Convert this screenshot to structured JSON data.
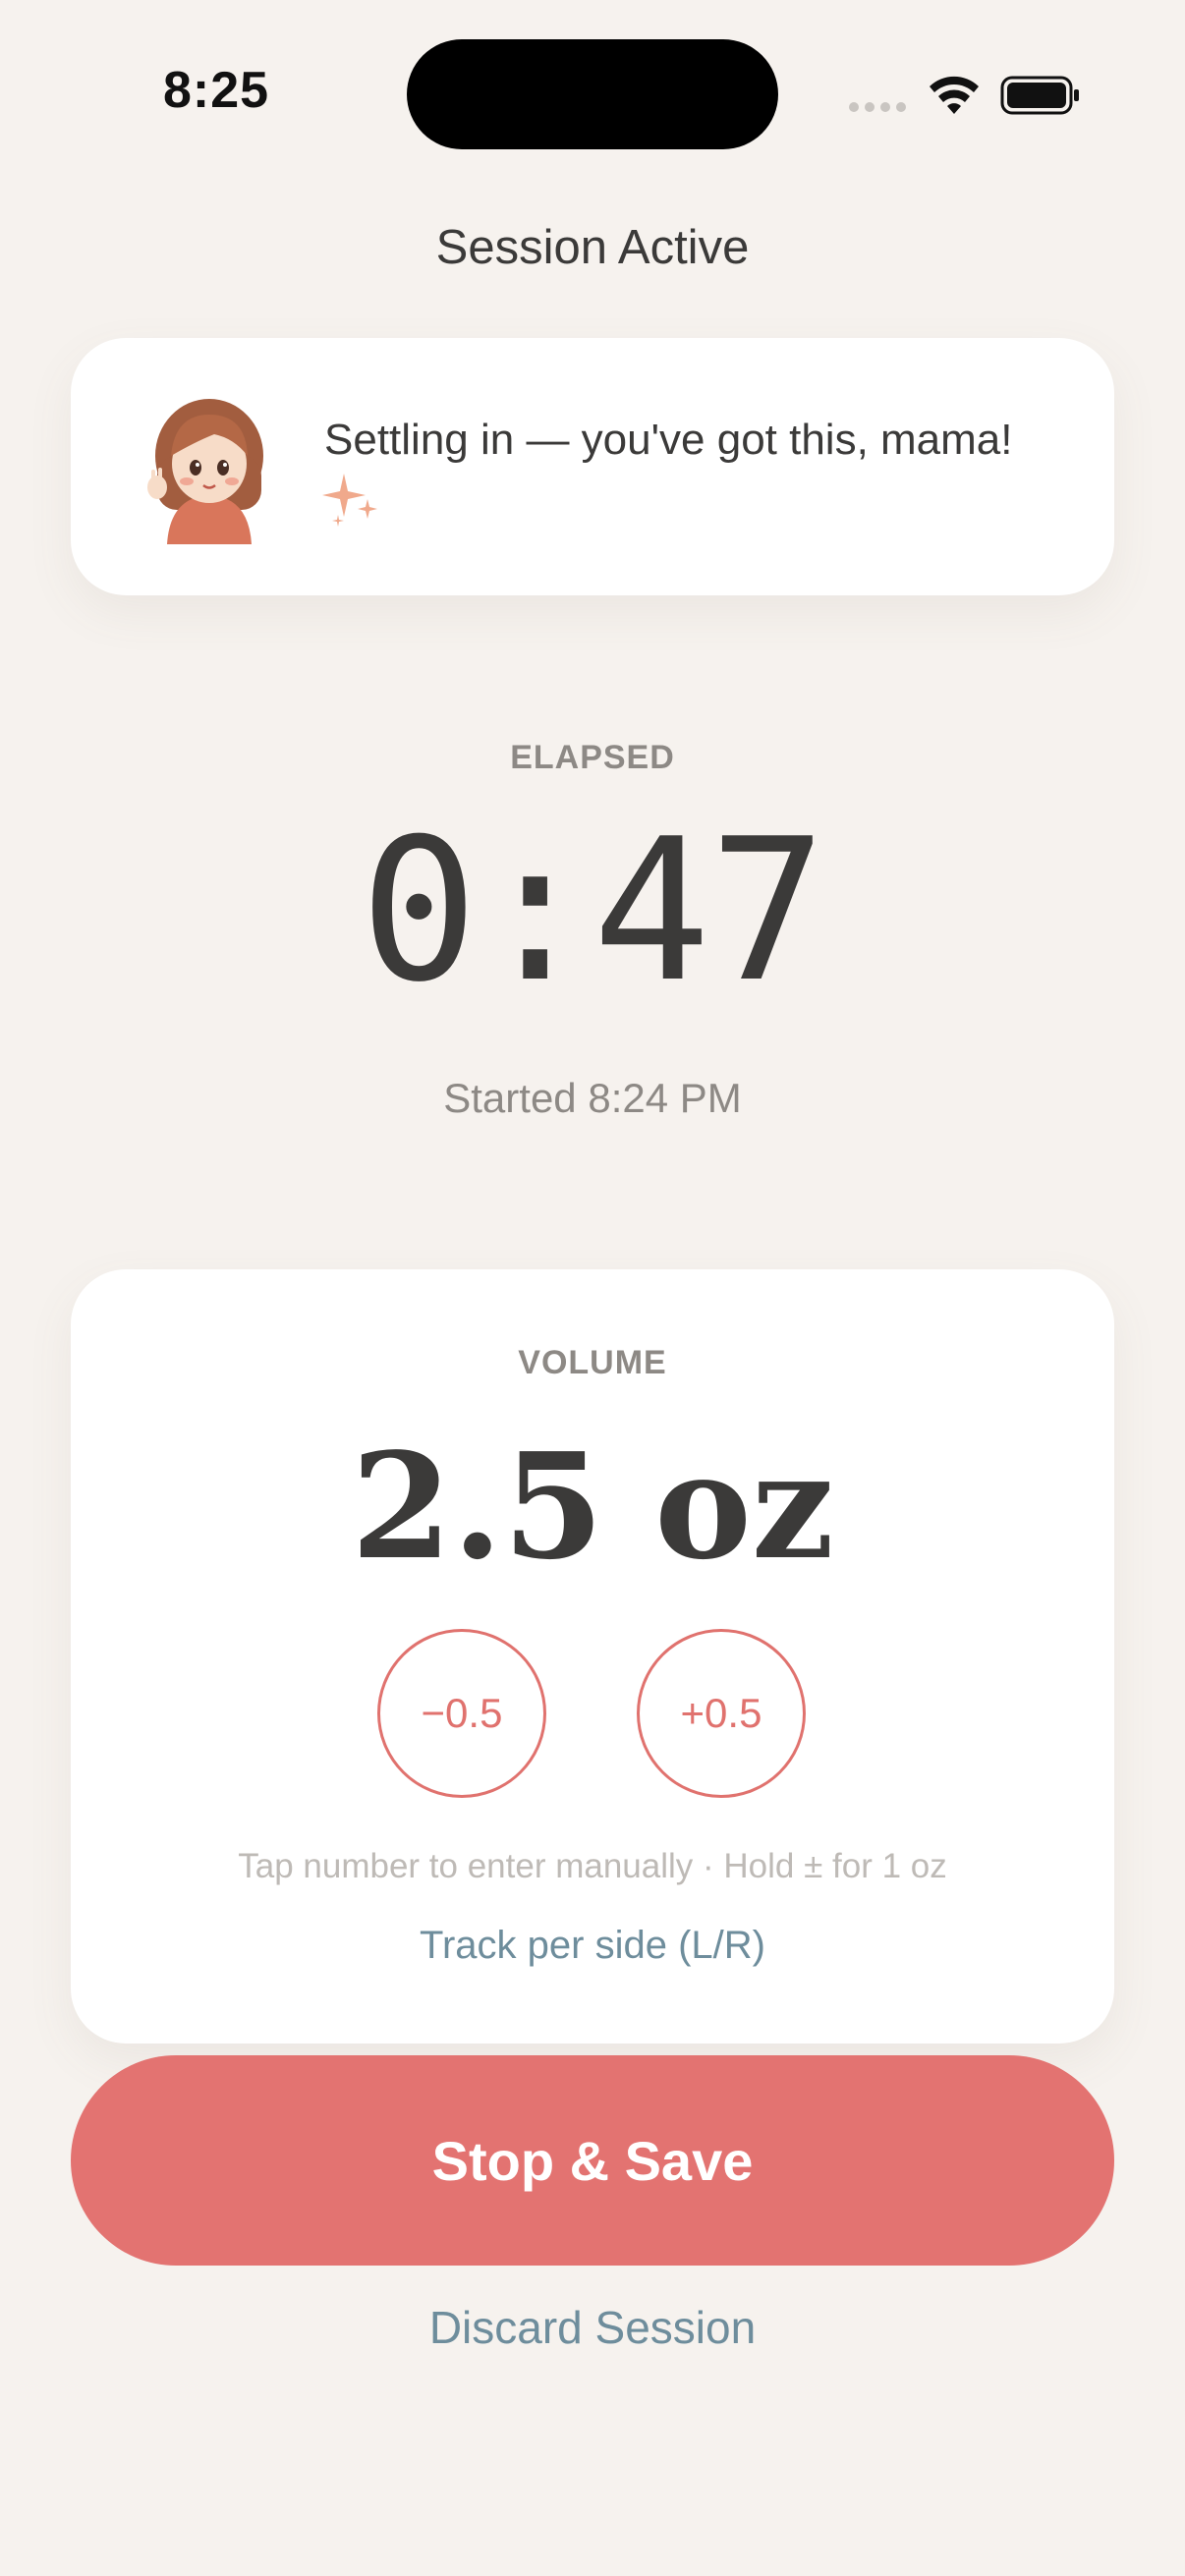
{
  "status_bar": {
    "time": "8:25",
    "icons": [
      "signal-icon",
      "wifi-icon",
      "battery-icon"
    ]
  },
  "header": {
    "title": "Session Active"
  },
  "cheer": {
    "avatar_icon": "mama-avatar-icon",
    "message": "Settling in — you've got this, mama!",
    "sparkle_icon": "sparkle-icon"
  },
  "elapsed": {
    "label": "ELAPSED",
    "value": "0:47",
    "started": "Started 8:24 PM"
  },
  "volume": {
    "label": "VOLUME",
    "value": "2.5 oz",
    "decrement_label": "−0.5",
    "increment_label": "+0.5",
    "hint": "Tap number to enter manually · Hold ± for 1 oz",
    "per_side_link": "Track per side (L/R)"
  },
  "actions": {
    "stop_save": "Stop & Save",
    "discard": "Discard Session"
  },
  "colors": {
    "background": "#F6F2EE",
    "card": "#FFFFFF",
    "accent": "#E37371",
    "link": "#6E8D9C",
    "text": "#3B3A39",
    "muted": "#8D8985"
  }
}
